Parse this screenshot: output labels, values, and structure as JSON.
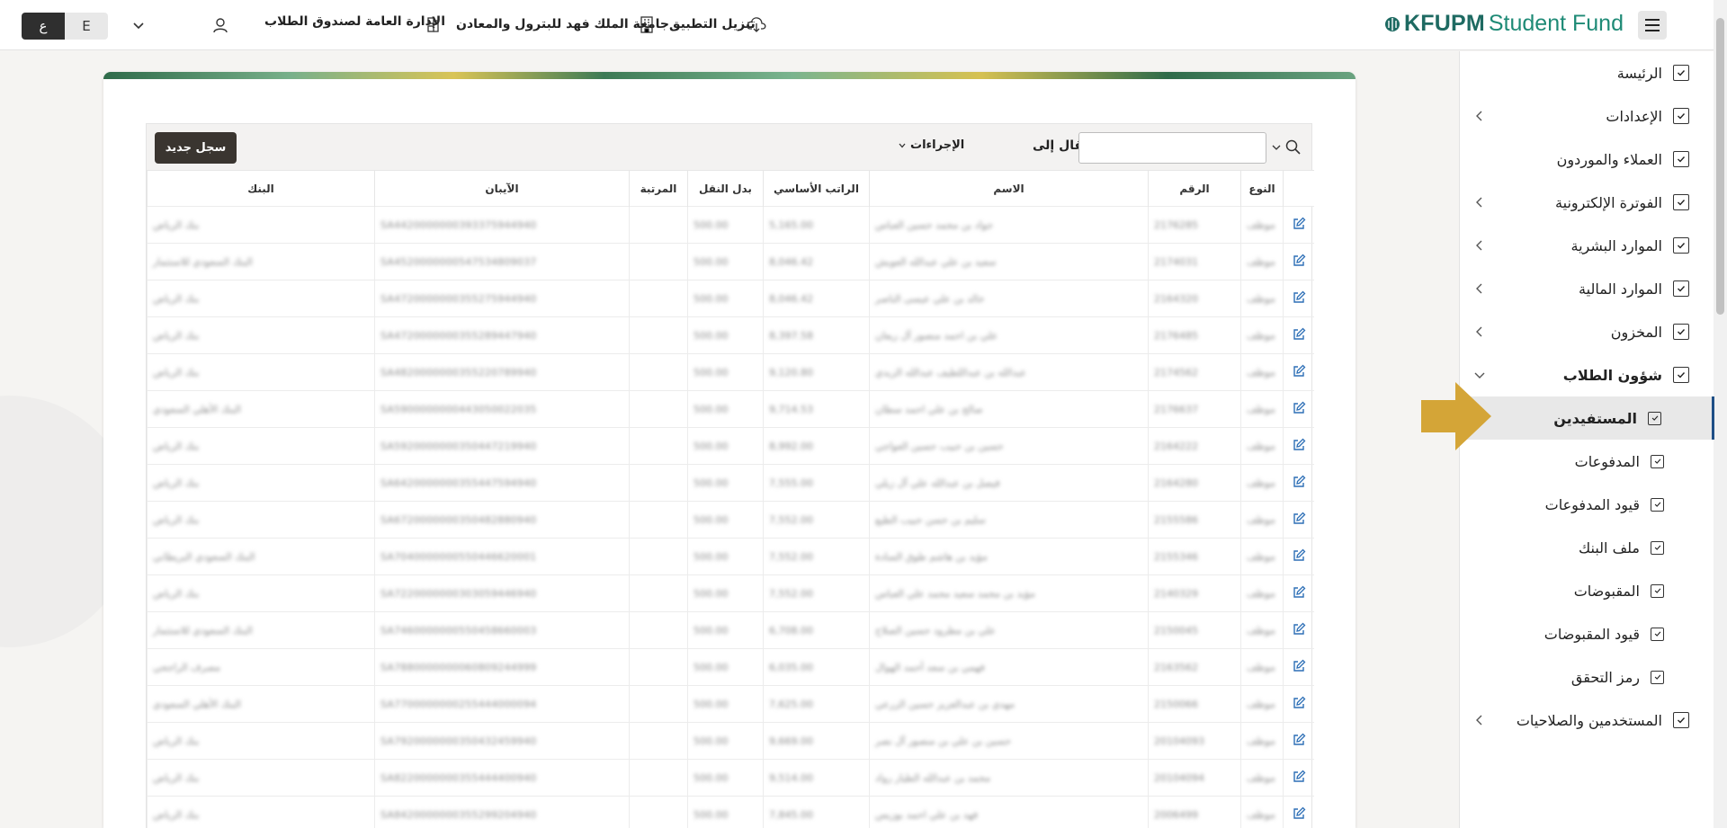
{
  "topbar": {
    "lang_active": "ع",
    "lang_other": "E",
    "org_label": "الإدارة العامة لصندوق الطلاب",
    "university_label": "جامعة الملك فهد للبترول والمعادن",
    "download_label": "تنزيل التطبيق",
    "brand_part1": "KFUPM",
    "brand_part2": "Student Fund"
  },
  "sidebar": {
    "items": [
      {
        "label": "الرئيسة",
        "has_arrow": false
      },
      {
        "label": "الإعدادات",
        "has_arrow": true
      },
      {
        "label": "العملاء والموردون",
        "has_arrow": false
      },
      {
        "label": "الفوترة الإلكترونية",
        "has_arrow": true
      },
      {
        "label": "الموارد البشرية",
        "has_arrow": true
      },
      {
        "label": "الموارد المالية",
        "has_arrow": true
      },
      {
        "label": "المخزون",
        "has_arrow": true
      },
      {
        "label": "شؤون الطلاب",
        "has_arrow": true,
        "expanded": true
      }
    ],
    "sub_items": [
      {
        "label": "المستفيدين",
        "active": true
      },
      {
        "label": "المدفوعات"
      },
      {
        "label": "قيود المدفوعات"
      },
      {
        "label": "ملف البنك"
      },
      {
        "label": "المقبوضات"
      },
      {
        "label": "قيود المقبوضات"
      },
      {
        "label": "رمز التحقق"
      }
    ],
    "last_item": {
      "label": "المستخدمين والصلاحيات"
    }
  },
  "toolbar": {
    "new_record": "سجل جديد",
    "actions": "الإجراءات",
    "goto": "انتقال إلى",
    "search_value": ""
  },
  "table": {
    "headers": [
      "النوع",
      "الرقم",
      "الاسم",
      "الراتب الأساسي",
      "بدل النقل",
      "المرتبة",
      "الآيبان",
      "البنك"
    ],
    "rows": [
      [
        "موظف",
        "2176285",
        "جواد بن محمد حسين العباس",
        "5,165.00",
        "500.00",
        "",
        "SA4420000000393375944940",
        "بنك الرياض"
      ],
      [
        "موظف",
        "2174031",
        "سعيد بن علي عبدالله العويش",
        "8,046.42",
        "500.00",
        "",
        "SA4520000000547534809037",
        "البنك السعودي للاستثمار"
      ],
      [
        "موظف",
        "2164320",
        "خالد بن علي عيسى الناصر",
        "8,046.42",
        "500.00",
        "",
        "SA4720000000355275944940",
        "بنك الرياض"
      ],
      [
        "موظف",
        "2176485",
        "علي بن احمد منصور آل ريعان",
        "8,397.58",
        "500.00",
        "",
        "SA4720000000355289447940",
        "بنك الرياض"
      ],
      [
        "موظف",
        "2174562",
        "عبدالله بن عبداللطيف عبدالله الزيدي",
        "9,120.80",
        "500.00",
        "",
        "SA4820000000355220789940",
        "بنك الرياض"
      ],
      [
        "موظف",
        "2176637",
        "صالح بن علي احمد سطان",
        "9,714.53",
        "500.00",
        "",
        "SA5900000000443050022035",
        "البنك الأهلي السعودي"
      ],
      [
        "موظف",
        "2164222",
        "حسين بن حبيب حسين العواجي",
        "8,992.00",
        "500.00",
        "",
        "SA5920000000350447219940",
        "بنك الرياض"
      ],
      [
        "موظف",
        "2164280",
        "فيصل بن عبدالله علي آل زيلي",
        "7,555.00",
        "500.00",
        "",
        "SA6420000000355447594940",
        "بنك الرياض"
      ],
      [
        "موظف",
        "2155586",
        "سليم بن حسن حبيب الطيع",
        "7,552.00",
        "500.00",
        "",
        "SA6720000000350482880940",
        "بنك الرياض"
      ],
      [
        "موظف",
        "2155346",
        "مؤيد بن هاشم طوق السادة",
        "7,552.00",
        "500.00",
        "",
        "SA7040000000550446620001",
        "البنك السعودي البريطاني"
      ],
      [
        "موظف",
        "2140329",
        "مؤيد بن محمد سعيد محمد علي العباس",
        "7,552.00",
        "500.00",
        "",
        "SA7220000000303059446940",
        "بنك الرياض"
      ],
      [
        "موظف",
        "2150045",
        "علي بن مطرود حسين الصلاح",
        "6,708.00",
        "500.00",
        "",
        "SA7460000000550458660003",
        "البنك السعودي للاستثمار"
      ],
      [
        "موظف",
        "2163562",
        "فهمي بن سعد أحمد الهوال",
        "6,035.00",
        "500.00",
        "",
        "SA7880000000060809244999",
        "مصرف الراجحي"
      ],
      [
        "موظف",
        "2150066",
        "مهدي بن عبدالغزيز حسين الزرعي",
        "7,625.00",
        "500.00",
        "",
        "SA7700000000255444000094",
        "البنك الأهلي السعودي"
      ],
      [
        "موظف",
        "20104093",
        "حسين بن علي بن منصور آل نصر",
        "9,669.00",
        "500.00",
        "",
        "SA7920000000350432459940",
        "بنك الرياض"
      ],
      [
        "موظف",
        "20104094",
        "محمد بن عبدالله الطيار رواد",
        "9,514.00",
        "500.00",
        "",
        "SA8220000000355444400940",
        "بنك الرياض"
      ],
      [
        "موظف",
        "2006499",
        "فهد بن علي احمد بوزيس",
        "7,845.00",
        "500.00",
        "",
        "SA8420000000355299204940",
        "بنك الرياض"
      ]
    ]
  },
  "colors": {
    "brand_dark": "#1e6a62",
    "brand_light": "#1e8a76",
    "primary_button": "#3a3530",
    "active_indicator": "#1f4f86",
    "pointer_arrow": "#d4a537",
    "edit_icon": "#2d6fb6"
  }
}
